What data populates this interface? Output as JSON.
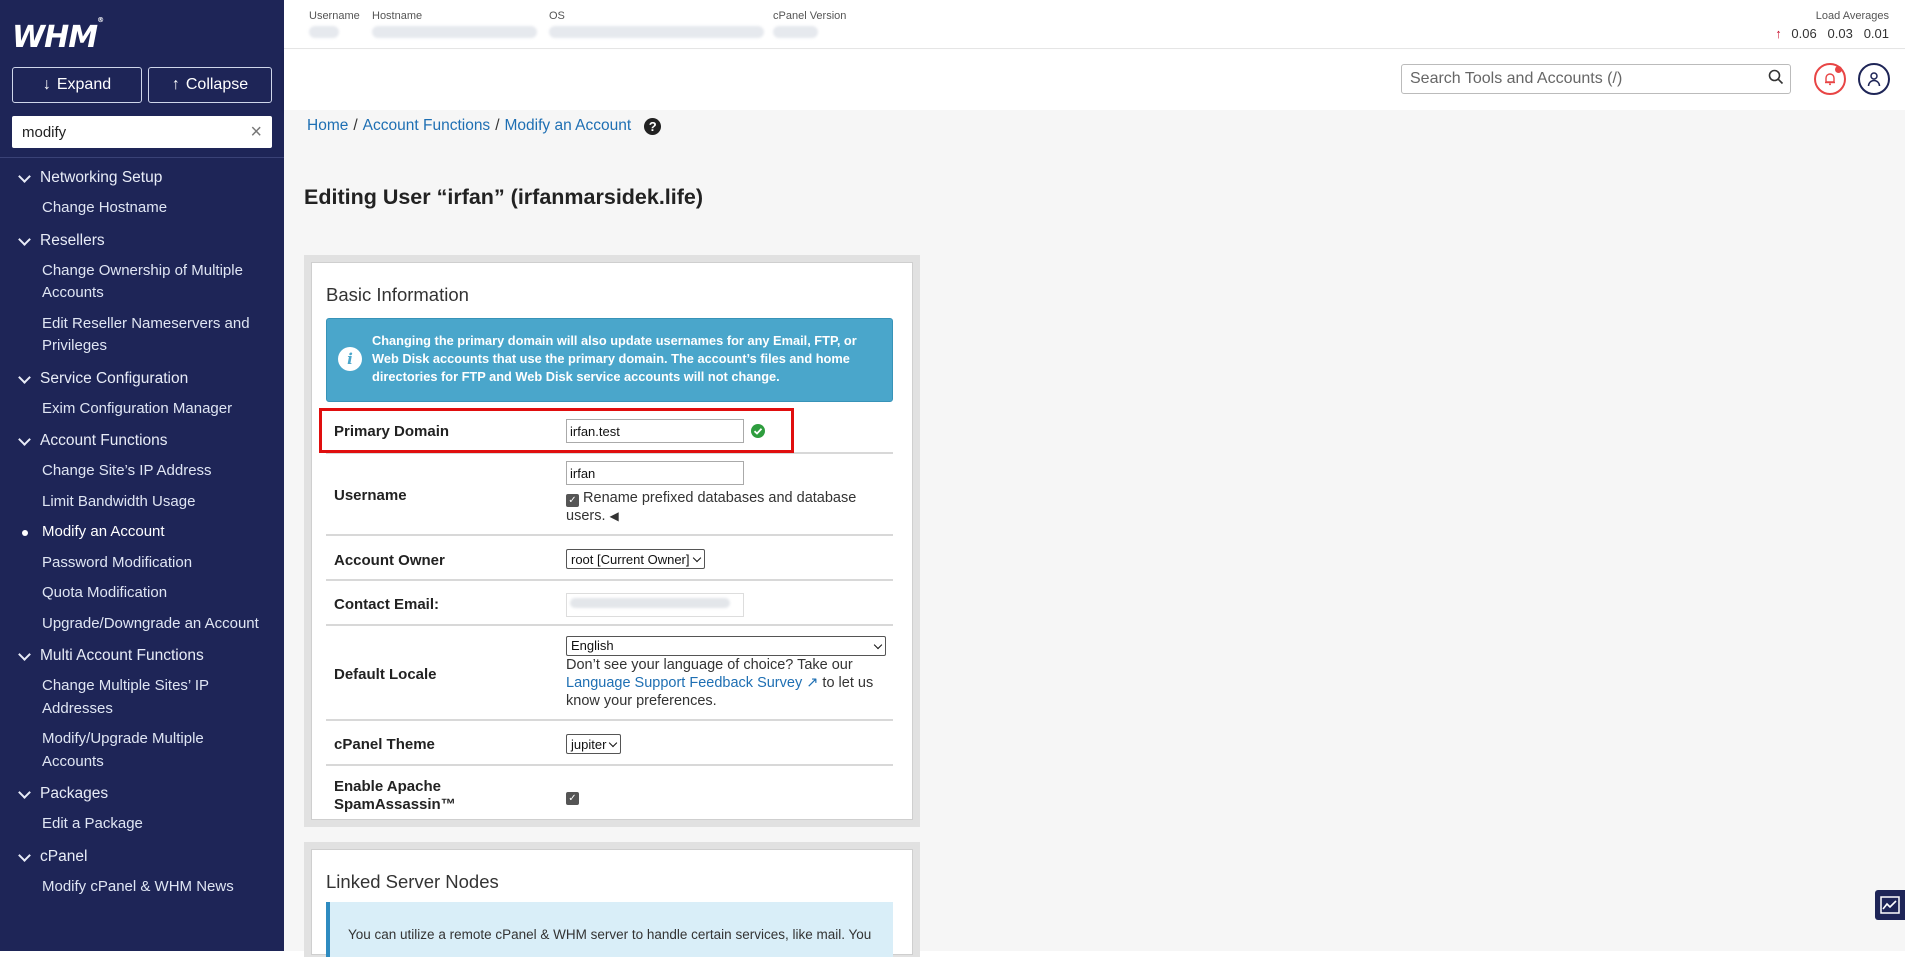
{
  "sidebar": {
    "logo": "WHM",
    "logo_mark": "®",
    "expand_label": "Expand",
    "collapse_label": "Collapse",
    "search_value": "modify",
    "groups": [
      {
        "label": "Networking Setup",
        "items": [
          "Change Hostname"
        ]
      },
      {
        "label": "Resellers",
        "items": [
          "Change Ownership of Multiple Accounts",
          "Edit Reseller Nameservers and Privileges"
        ]
      },
      {
        "label": "Service Configuration",
        "items": [
          "Exim Configuration Manager"
        ]
      },
      {
        "label": "Account Functions",
        "items": [
          "Change Site’s IP Address",
          "Limit Bandwidth Usage",
          "Modify an Account",
          "Password Modification",
          "Quota Modification",
          "Upgrade/Downgrade an Account"
        ]
      },
      {
        "label": "Multi Account Functions",
        "items": [
          "Change Multiple Sites’ IP Addresses",
          "Modify/Upgrade Multiple Accounts"
        ]
      },
      {
        "label": "Packages",
        "items": [
          "Edit a Package"
        ]
      },
      {
        "label": "cPanel",
        "items": [
          "Modify cPanel & WHM News"
        ]
      }
    ],
    "active_item": "Modify an Account"
  },
  "topbar": {
    "username_label": "Username",
    "hostname_label": "Hostname",
    "os_label": "OS",
    "cpanel_version_label": "cPanel Version",
    "load_label": "Load Averages",
    "load_1": "0.06",
    "load_5": "0.03",
    "load_15": "0.01",
    "load_arrow": "↑"
  },
  "secondbar": {
    "search_placeholder": "Search Tools and Accounts (/)"
  },
  "breadcrumb": {
    "home": "Home",
    "section": "Account Functions",
    "page": "Modify an Account",
    "sep": "/"
  },
  "page_title": "Editing User “irfan” (irfanmarsidek.life)",
  "basic": {
    "title": "Basic Information",
    "alert": "Changing the primary domain will also update usernames for any Email, FTP, or Web Disk accounts that use the primary domain. The account’s files and home directories for FTP and Web Disk service accounts will not change.",
    "primary_domain_label": "Primary Domain",
    "primary_domain_value": "irfan.test",
    "username_label": "Username",
    "username_value": "irfan",
    "rename_label": "Rename prefixed databases and database users.",
    "owner_label": "Account Owner",
    "owner_value": "root [Current Owner]",
    "email_label": "Contact Email:",
    "locale_label": "Default Locale",
    "locale_value": "English",
    "locale_help_pre": "Don’t see your language of choice? Take our",
    "locale_help_link": "Language Support Feedback Survey",
    "locale_help_post": "to let us know your preferences.",
    "theme_label": "cPanel Theme",
    "theme_value": "jupiter",
    "spam_label": "Enable Apache SpamAssassin™"
  },
  "linked": {
    "title": "Linked Server Nodes",
    "alert": "You can utilize a remote cPanel & WHM server to handle certain services, like mail. You"
  },
  "colors": {
    "sidebar_bg": "#1e2557",
    "link": "#1e6fb3",
    "alert_bg": "#4aa6cb",
    "highlight": "#e00e0e"
  }
}
